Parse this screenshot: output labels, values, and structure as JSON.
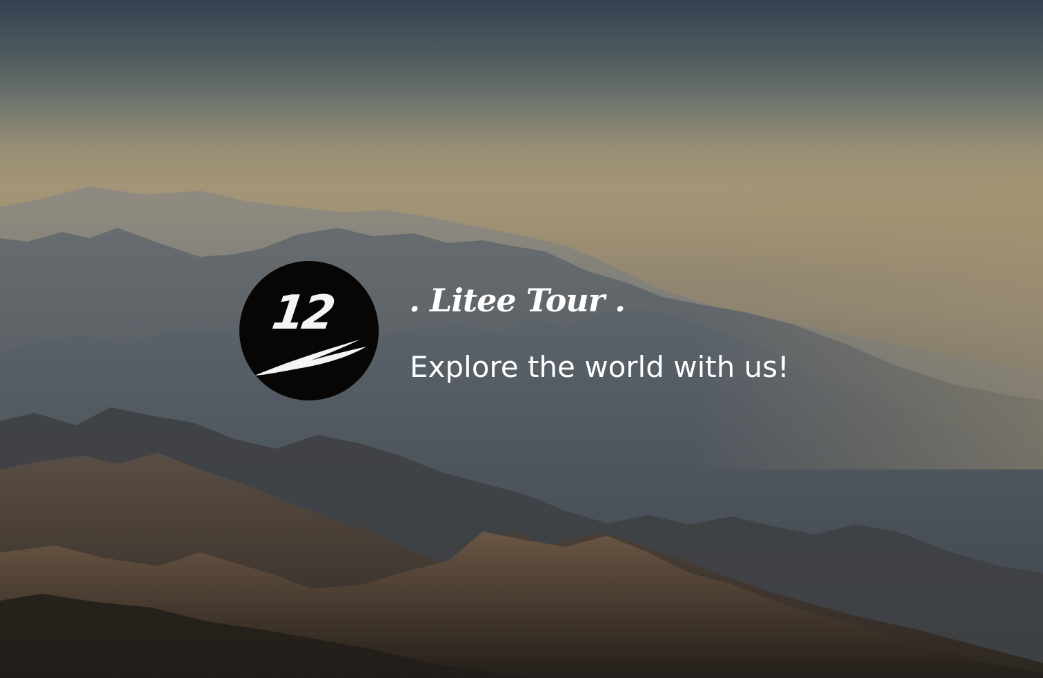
{
  "hero": {
    "brand_title": ". Litee Tour .",
    "tagline": "Explore the world with us!",
    "logo_icon": "brand-logo-icon",
    "logo_text": "12"
  },
  "colors": {
    "text": "#ffffff",
    "logo_background": "#070605",
    "sky_top": "#334152",
    "haze": "#968a6e",
    "mountain_dark": "#2c2824"
  }
}
